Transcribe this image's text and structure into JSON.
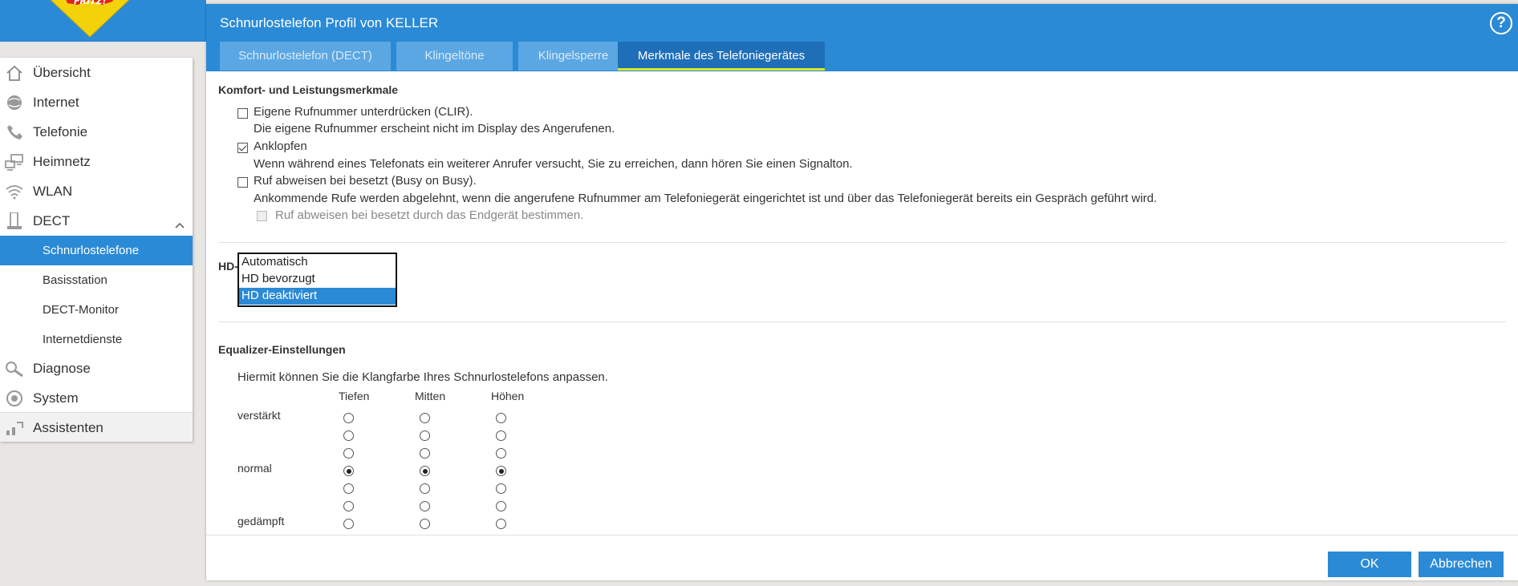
{
  "window": {
    "title": "Schnurlostelefon Profil von KELLER",
    "help_label": "?"
  },
  "sidebar": {
    "items": [
      {
        "label": "Übersicht",
        "icon": "home-icon"
      },
      {
        "label": "Internet",
        "icon": "globe-icon"
      },
      {
        "label": "Telefonie",
        "icon": "phone-icon"
      },
      {
        "label": "Heimnetz",
        "icon": "network-icon"
      },
      {
        "label": "WLAN",
        "icon": "wifi-icon"
      },
      {
        "label": "DECT",
        "icon": "dect-phone-icon",
        "expanded": true
      },
      {
        "label": "Diagnose",
        "icon": "diagnose-icon"
      },
      {
        "label": "System",
        "icon": "system-gear-icon"
      },
      {
        "label": "Assistenten",
        "icon": "assistant-icon"
      }
    ],
    "dect_sub": [
      {
        "label": "Schnurlostelefone",
        "active": true
      },
      {
        "label": "Basisstation"
      },
      {
        "label": "DECT-Monitor"
      },
      {
        "label": "Internetdienste"
      }
    ]
  },
  "tabs": [
    {
      "label": "Schnurlostelefon (DECT)"
    },
    {
      "label": "Klingeltöne"
    },
    {
      "label": "Klingelsperre"
    },
    {
      "label": "Merkmale des Telefoniegerätes",
      "active": true
    }
  ],
  "komfort": {
    "title": "Komfort- und Leistungsmerkmale",
    "clir_label": "Eigene Rufnummer unterdrücken (CLIR).",
    "clir_desc": "Die eigene Rufnummer erscheint nicht im Display des Angerufenen.",
    "clir_checked": false,
    "anklopfen_label": "Anklopfen",
    "anklopfen_desc": "Wenn während eines Telefonats ein weiterer Anrufer versucht, Sie zu erreichen, dann hören Sie einen Signalton.",
    "anklopfen_checked": true,
    "busy_label": "Ruf abweisen bei besetzt (Busy on Busy).",
    "busy_desc": "Ankommende Rufe werden abgelehnt, wenn die angerufene Rufnummer am Telefoniegerät eingerichtet ist und über das Telefoniegerät bereits ein Gespräch geführt wird.",
    "busy_checked": false,
    "busy_device_label": "Ruf abweisen bei besetzt durch das Endgerät bestimmen.",
    "busy_device_checked": false
  },
  "hd": {
    "label": "HD-",
    "options": [
      "Automatisch",
      "HD bevorzugt",
      "HD deaktiviert"
    ],
    "selected": "HD deaktiviert"
  },
  "equalizer": {
    "title": "Equalizer-Einstellungen",
    "desc": "Hiermit können Sie die Klangfarbe Ihres Schnurlostelefons anpassen.",
    "columns": [
      "Tiefen",
      "Mitten",
      "Höhen"
    ],
    "row_labels": [
      "verstärkt",
      "",
      "",
      "normal",
      "",
      "",
      "gedämpft"
    ],
    "selected_level": {
      "Tiefen": "normal",
      "Mitten": "normal",
      "Höhen": "normal"
    }
  },
  "footer": {
    "ok_label": "OK",
    "cancel_label": "Abbrechen"
  },
  "colors": {
    "accent": "#2b8ad6",
    "tab_inactive": "#5aa7e3",
    "tab_active": "#1f6fb8",
    "tab_underline": "#d8ea27"
  }
}
